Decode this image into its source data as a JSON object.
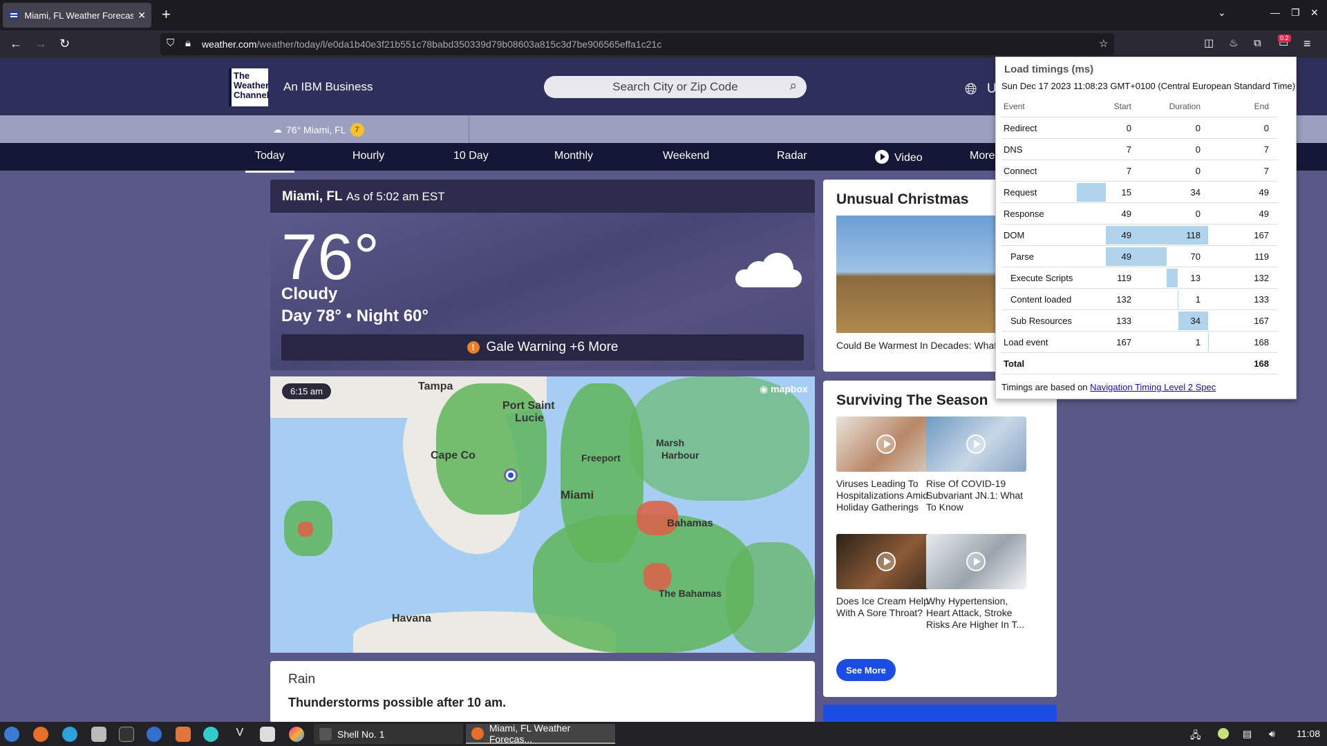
{
  "browser": {
    "tab_title": "Miami, FL Weather Forecast",
    "new_tab": "+",
    "close_tab": "✕",
    "url_host": "weather.com",
    "url_path": "/weather/today/l/e0da1b40e3f21b551c78babd350339d79b08603a815c3d7be906565effa1c21c",
    "extension_badge": "0.2"
  },
  "site": {
    "logo_text": "The Weather Channel",
    "ibm": "An IBM Business",
    "search_placeholder": "Search City or Zip Code",
    "unit_partial": "U"
  },
  "strip": {
    "current": "76° Miami, FL",
    "alert_count": "7"
  },
  "nav": {
    "items": [
      "Today",
      "Hourly",
      "10 Day",
      "Monthly",
      "Weekend",
      "Radar",
      "Video",
      "More"
    ]
  },
  "conditions": {
    "location": "Miami, FL",
    "as_of": "As of 5:02 am EST",
    "temp": "76°",
    "phrase": "Cloudy",
    "day_night": "Day 78° • Night 60°",
    "alert": "Gale Warning +6 More"
  },
  "map": {
    "time": "6:15 am",
    "attribution": "mapbox",
    "cities": [
      "Tampa",
      "Port Saint",
      "Lucie",
      "Cape Co",
      "Freeport",
      "Marsh",
      "Harbour",
      "Miami",
      "Bahamas",
      "The Bahamas",
      "Havana"
    ]
  },
  "rain": {
    "heading": "Rain",
    "text": "Thunderstorms possible after 10 am."
  },
  "unusual": {
    "heading": "Unusual Christmas",
    "caption": "Could Be Warmest In Decades: What"
  },
  "season": {
    "heading": "Surviving The Season",
    "articles": [
      {
        "title": "Viruses Leading To Hospitalizations Amid Holiday Gatherings"
      },
      {
        "title": "Rise Of COVID-19 Subvariant JN.1: What To Know"
      },
      {
        "title": "Does Ice Cream Help With A Sore Throat?"
      },
      {
        "title": "Why Hypertension, Heart Attack, Stroke Risks Are Higher In T..."
      }
    ],
    "see_more": "See More"
  },
  "timings": {
    "title": "Load timings (ms)",
    "date": "Sun Dec 17 2023 11:08:23 GMT+0100 (Central European Standard Time)",
    "headers": [
      "Event",
      "Start",
      "Duration",
      "End"
    ],
    "total_max": 168,
    "rows": [
      {
        "event": "Redirect",
        "start": "0",
        "duration": "0",
        "end": "0",
        "s": 0,
        "e": 0
      },
      {
        "event": "DNS",
        "start": "7",
        "duration": "0",
        "end": "7",
        "s": 7,
        "e": 7
      },
      {
        "event": "Connect",
        "start": "7",
        "duration": "0",
        "end": "7",
        "s": 7,
        "e": 7
      },
      {
        "event": "Request",
        "start": "15",
        "duration": "34",
        "end": "49",
        "s": 15,
        "e": 49
      },
      {
        "event": "Response",
        "start": "49",
        "duration": "0",
        "end": "49",
        "s": 49,
        "e": 49
      },
      {
        "event": "DOM",
        "start": "49",
        "duration": "118",
        "end": "167",
        "s": 49,
        "e": 167
      },
      {
        "event": "Parse",
        "start": "49",
        "duration": "70",
        "end": "119",
        "s": 49,
        "e": 119,
        "indent": true
      },
      {
        "event": "Execute Scripts",
        "start": "119",
        "duration": "13",
        "end": "132",
        "s": 119,
        "e": 132,
        "indent": true
      },
      {
        "event": "Content loaded",
        "start": "132",
        "duration": "1",
        "end": "133",
        "s": 132,
        "e": 133,
        "indent": true
      },
      {
        "event": "Sub Resources",
        "start": "133",
        "duration": "34",
        "end": "167",
        "s": 133,
        "e": 167,
        "indent": true
      },
      {
        "event": "Load event",
        "start": "167",
        "duration": "1",
        "end": "168",
        "s": 167,
        "e": 168
      },
      {
        "event": "Total",
        "start": "",
        "duration": "",
        "end": "168",
        "s": 0,
        "e": 0,
        "bold": true
      }
    ],
    "footer_text": "Timings are based on",
    "footer_link": "Navigation Timing Level 2 Spec"
  },
  "taskbar": {
    "tasks": [
      "Shell No. 1",
      "Miami, FL Weather Forecas..."
    ],
    "clock": "11:08"
  }
}
